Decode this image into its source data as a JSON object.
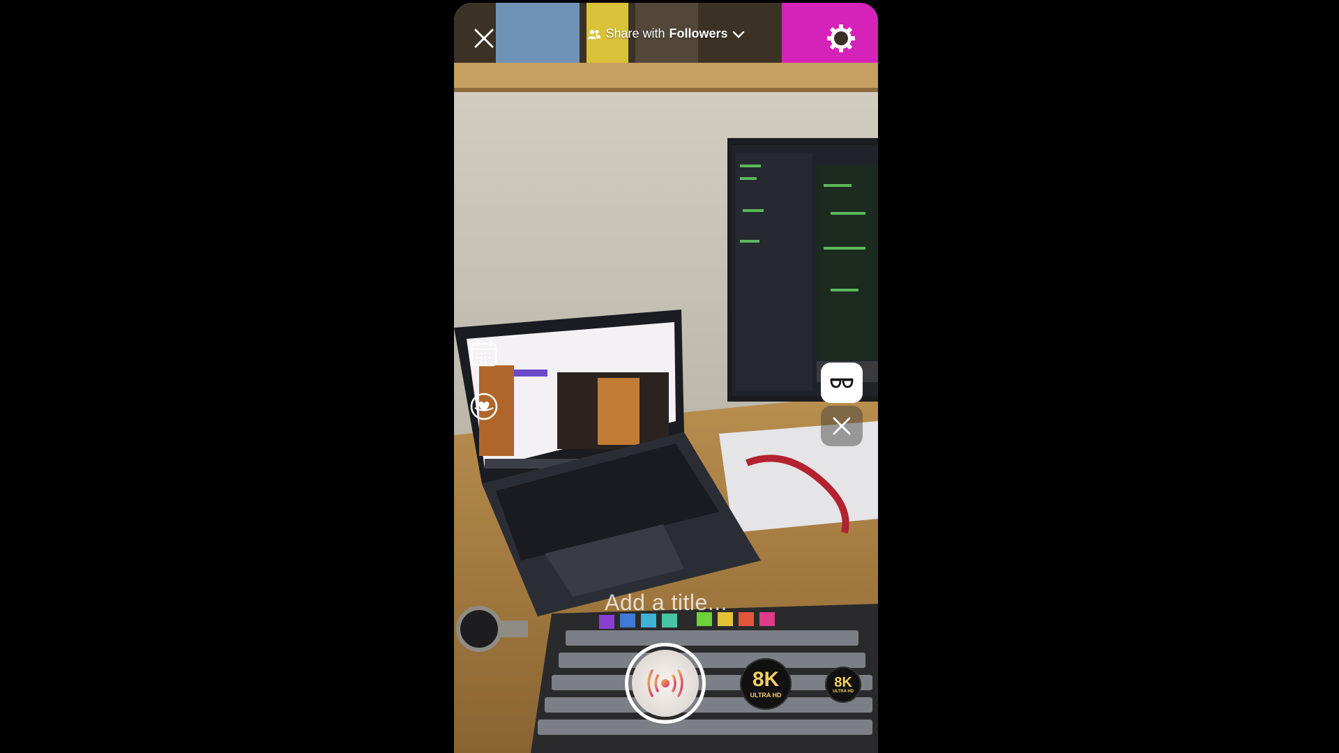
{
  "header": {
    "share_prefix": "Share with",
    "share_audience": "Followers"
  },
  "title_placeholder": "Add a title...",
  "icons": {
    "close": "close-icon",
    "settings": "gear-icon",
    "schedule": "calendar-icon",
    "fundraiser": "heart-badge-icon",
    "effect": "glasses-icon",
    "effect_close": "close-icon",
    "go_live": "broadcast-icon"
  },
  "effects": [
    {
      "label": "8K",
      "sublabel": "ULTRA HD"
    },
    {
      "label": "8K",
      "sublabel": "ULTRA HD"
    }
  ],
  "colors": {
    "live_button_ring": "#ffffff",
    "live_button_gradient_start": "#f3b04a",
    "live_button_gradient_end": "#d0307a",
    "badge_gold": "#f0c24a"
  }
}
